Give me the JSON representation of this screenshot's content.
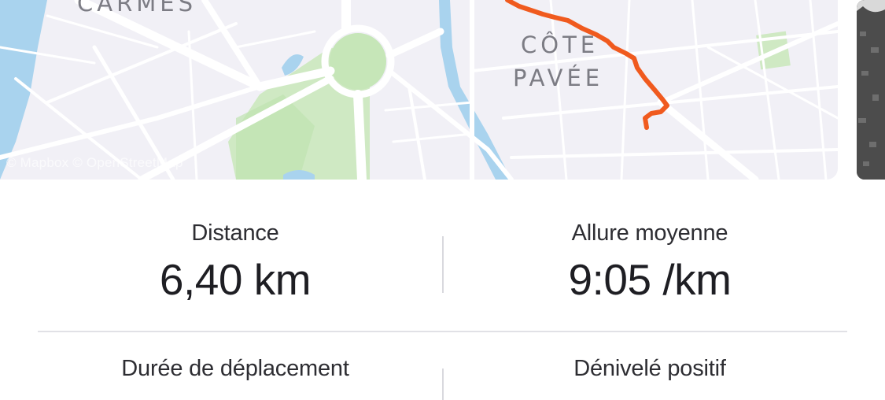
{
  "map": {
    "labels": {
      "carmes": "CARMES",
      "cote_line1": "CÔTE",
      "cote_line2": "PAVÉE"
    },
    "attribution": "© Mapbox © OpenStreetMap",
    "route_color": "#f05a1e",
    "water_color": "#a9d3ee",
    "park_color": "#c9e7bc"
  },
  "stats": {
    "distance": {
      "label": "Distance",
      "value": "6,40 km"
    },
    "pace": {
      "label": "Allure moyenne",
      "value": "9:05 /km"
    },
    "moving_time": {
      "label": "Durée de déplacement"
    },
    "elevation": {
      "label": "Dénivelé positif"
    }
  }
}
